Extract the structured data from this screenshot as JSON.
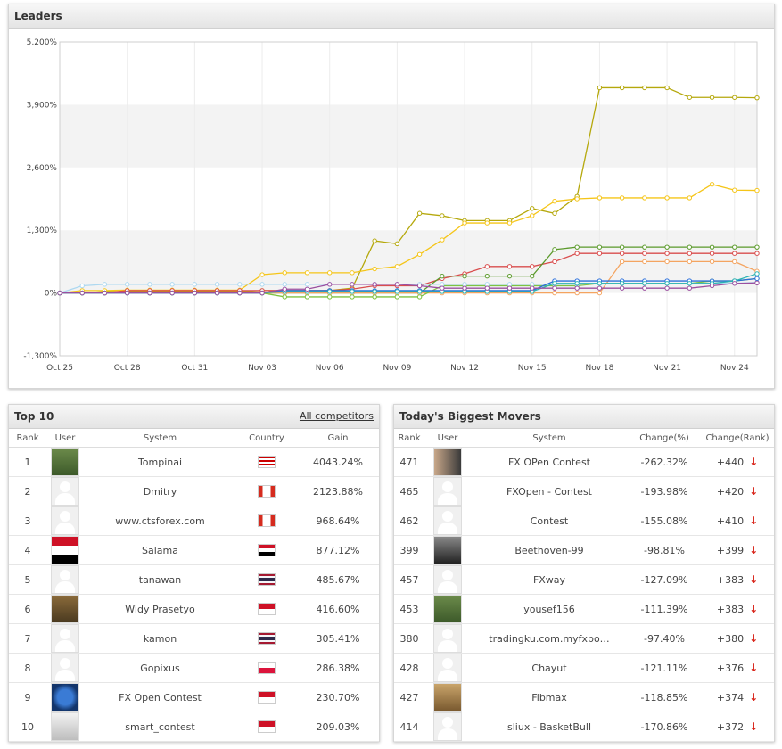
{
  "leaders": {
    "title": "Leaders"
  },
  "chart_data": {
    "type": "line",
    "x": [
      "Oct 25",
      "Oct 26",
      "Oct 27",
      "Oct 28",
      "Oct 29",
      "Oct 30",
      "Oct 31",
      "Nov 01",
      "Nov 02",
      "Nov 03",
      "Nov 04",
      "Nov 05",
      "Nov 06",
      "Nov 07",
      "Nov 08",
      "Nov 09",
      "Nov 10",
      "Nov 11",
      "Nov 12",
      "Nov 13",
      "Nov 14",
      "Nov 15",
      "Nov 16",
      "Nov 17",
      "Nov 18",
      "Nov 19",
      "Nov 20",
      "Nov 21",
      "Nov 22",
      "Nov 23",
      "Nov 24",
      "Nov 25"
    ],
    "xticks": [
      "Oct 25",
      "Oct 28",
      "Oct 31",
      "Nov 03",
      "Nov 06",
      "Nov 09",
      "Nov 12",
      "Nov 15",
      "Nov 18",
      "Nov 21",
      "Nov 24"
    ],
    "yticks": [
      "-1,300%",
      "0%",
      "1,300%",
      "2,600%",
      "3,900%",
      "5,200%"
    ],
    "ylim": [
      -1300,
      5200
    ],
    "series": [
      {
        "color": "#b5a80c",
        "values": [
          0,
          0,
          30,
          30,
          30,
          30,
          30,
          30,
          30,
          50,
          50,
          50,
          50,
          100,
          1080,
          1020,
          1650,
          1600,
          1500,
          1500,
          1500,
          1750,
          1650,
          2000,
          4250,
          4250,
          4250,
          4250,
          4050,
          4050,
          4050,
          4043
        ]
      },
      {
        "color": "#f5c518",
        "values": [
          0,
          50,
          50,
          60,
          60,
          60,
          60,
          60,
          60,
          380,
          420,
          420,
          420,
          420,
          500,
          550,
          800,
          1100,
          1450,
          1450,
          1450,
          1600,
          1900,
          1950,
          1970,
          1970,
          1970,
          1970,
          1970,
          2250,
          2130,
          2124
        ]
      },
      {
        "color": "#d94d4d",
        "values": [
          0,
          0,
          0,
          50,
          50,
          50,
          50,
          50,
          50,
          50,
          50,
          50,
          50,
          80,
          150,
          150,
          150,
          300,
          400,
          550,
          550,
          550,
          650,
          820,
          820,
          820,
          820,
          820,
          820,
          820,
          820,
          820
        ]
      },
      {
        "color": "#5b9a2b",
        "values": [
          0,
          0,
          0,
          0,
          0,
          0,
          0,
          0,
          0,
          0,
          0,
          0,
          0,
          0,
          0,
          0,
          0,
          350,
          350,
          350,
          350,
          350,
          900,
          950,
          950,
          950,
          950,
          950,
          950,
          950,
          950,
          950
        ]
      },
      {
        "color": "#f4a460",
        "values": [
          0,
          0,
          0,
          0,
          0,
          0,
          0,
          0,
          0,
          0,
          0,
          0,
          0,
          0,
          0,
          0,
          0,
          0,
          0,
          0,
          0,
          0,
          0,
          0,
          0,
          650,
          650,
          650,
          650,
          650,
          650,
          450
        ]
      },
      {
        "color": "#7fc241",
        "values": [
          0,
          0,
          0,
          0,
          0,
          0,
          0,
          0,
          0,
          0,
          -80,
          -80,
          -80,
          -80,
          -80,
          -80,
          -80,
          150,
          150,
          150,
          150,
          150,
          150,
          150,
          200,
          200,
          200,
          200,
          200,
          250,
          250,
          300
        ]
      },
      {
        "color": "#add8f0",
        "values": [
          0,
          150,
          180,
          180,
          180,
          180,
          180,
          180,
          180,
          180,
          180,
          180,
          180,
          180,
          180,
          180,
          180,
          180,
          180,
          180,
          180,
          180,
          180,
          180,
          200,
          200,
          200,
          200,
          200,
          200,
          200,
          220
        ]
      },
      {
        "color": "#2a6fdb",
        "values": [
          0,
          0,
          0,
          0,
          0,
          0,
          0,
          0,
          0,
          0,
          50,
          50,
          50,
          50,
          50,
          50,
          50,
          50,
          50,
          50,
          50,
          50,
          250,
          250,
          250,
          250,
          250,
          250,
          250,
          250,
          250,
          300
        ]
      },
      {
        "color": "#2bb3b3",
        "values": [
          0,
          0,
          0,
          0,
          0,
          0,
          0,
          0,
          0,
          0,
          30,
          30,
          30,
          30,
          30,
          30,
          30,
          30,
          30,
          30,
          30,
          30,
          200,
          200,
          200,
          200,
          200,
          200,
          200,
          200,
          250,
          400
        ]
      },
      {
        "color": "#9b4fa0",
        "values": [
          0,
          0,
          0,
          0,
          0,
          0,
          0,
          0,
          0,
          0,
          80,
          80,
          180,
          180,
          180,
          180,
          150,
          100,
          100,
          100,
          100,
          100,
          100,
          100,
          100,
          100,
          100,
          100,
          100,
          150,
          200,
          209
        ]
      }
    ]
  },
  "top10": {
    "title": "Top 10",
    "link": "All competitors",
    "headers": {
      "rank": "Rank",
      "user": "User",
      "system": "System",
      "country": "Country",
      "gain": "Gain"
    },
    "rows": [
      {
        "rank": "1",
        "system": "Tompinai",
        "gain": "4043.24%",
        "avatar": "photo-green",
        "flag": "malaysia"
      },
      {
        "rank": "2",
        "system": "Dmitry",
        "gain": "2123.88%",
        "avatar": "placeholder",
        "flag": "canada"
      },
      {
        "rank": "3",
        "system": "www.ctsforex.com",
        "gain": "968.64%",
        "avatar": "placeholder",
        "flag": "canada"
      },
      {
        "rank": "4",
        "system": "Salama",
        "gain": "877.12%",
        "avatar": "flag-egypt",
        "flag": "egypt"
      },
      {
        "rank": "5",
        "system": "tanawan",
        "gain": "485.67%",
        "avatar": "placeholder",
        "flag": "thailand"
      },
      {
        "rank": "6",
        "system": "Widy Prasetyo",
        "gain": "416.60%",
        "avatar": "photo-brown",
        "flag": "indonesia"
      },
      {
        "rank": "7",
        "system": "kamon",
        "gain": "305.41%",
        "avatar": "placeholder",
        "flag": "thailand"
      },
      {
        "rank": "8",
        "system": "Gopixus",
        "gain": "286.38%",
        "avatar": "placeholder",
        "flag": "poland"
      },
      {
        "rank": "9",
        "system": "FX Open Contest",
        "gain": "230.70%",
        "avatar": "photo-blue",
        "flag": "indonesia"
      },
      {
        "rank": "10",
        "system": "smart_contest",
        "gain": "209.03%",
        "avatar": "photo-figure",
        "flag": "indonesia"
      }
    ]
  },
  "movers": {
    "title": "Today's Biggest Movers",
    "headers": {
      "rank": "Rank",
      "user": "User",
      "system": "System",
      "change_pct": "Change(%)",
      "change_rank": "Change(Rank)"
    },
    "rows": [
      {
        "rank": "471",
        "system": "FX OPen Contest",
        "change_pct": "-262.32%",
        "change_rank": "+440",
        "avatar": "photo-people"
      },
      {
        "rank": "465",
        "system": "FXOpen - Contest",
        "change_pct": "-193.98%",
        "change_rank": "+420",
        "avatar": "placeholder"
      },
      {
        "rank": "462",
        "system": "Contest",
        "change_pct": "-155.08%",
        "change_rank": "+410",
        "avatar": "placeholder"
      },
      {
        "rank": "399",
        "system": "Beethoven-99",
        "change_pct": "-98.81%",
        "change_rank": "+399",
        "avatar": "photo-bw"
      },
      {
        "rank": "457",
        "system": "FXway",
        "change_pct": "-127.09%",
        "change_rank": "+383",
        "avatar": "placeholder"
      },
      {
        "rank": "453",
        "system": "yousef156",
        "change_pct": "-111.39%",
        "change_rank": "+383",
        "avatar": "photo-green"
      },
      {
        "rank": "380",
        "system": "tradingku.com.myfxbo…",
        "change_pct": "-97.40%",
        "change_rank": "+380",
        "avatar": "placeholder"
      },
      {
        "rank": "428",
        "system": "Chayut",
        "change_pct": "-121.11%",
        "change_rank": "+376",
        "avatar": "placeholder"
      },
      {
        "rank": "427",
        "system": "Fibmax",
        "change_pct": "-118.85%",
        "change_rank": "+374",
        "avatar": "photo-cat"
      },
      {
        "rank": "414",
        "system": "sliux - BasketBull",
        "change_pct": "-170.86%",
        "change_rank": "+372",
        "avatar": "placeholder"
      }
    ]
  }
}
